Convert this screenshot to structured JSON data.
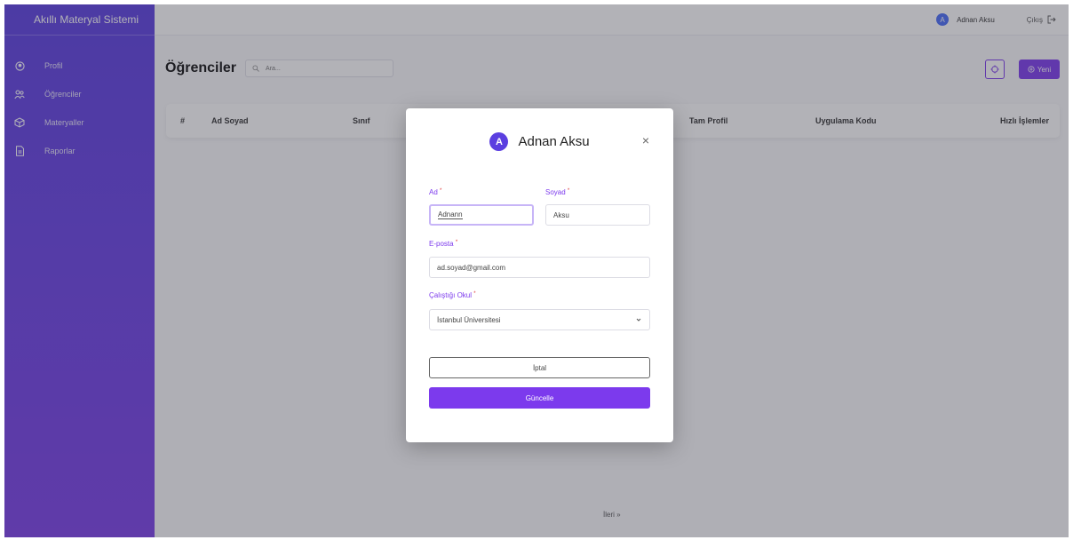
{
  "app": {
    "brand": "Akıllı Materyal Sistemi"
  },
  "sidebar": {
    "items": [
      {
        "label": "Profil",
        "icon": "user-circle-icon"
      },
      {
        "label": "Öğrenciler",
        "icon": "users-icon"
      },
      {
        "label": "Materyaller",
        "icon": "box-icon"
      },
      {
        "label": "Raporlar",
        "icon": "file-icon"
      }
    ]
  },
  "topbar": {
    "user_initial": "A",
    "user_name": "Adnan Aksu",
    "logout_label": "Çıkış"
  },
  "page": {
    "title": "Öğrenciler",
    "search_placeholder": "Ara...",
    "new_label": "Yeni",
    "columns": [
      "#",
      "Ad Soyad",
      "Sınıf",
      "Tam Profil",
      "Uygulama Kodu",
      "Hızlı İşlemler"
    ],
    "pager_next": "İleri »"
  },
  "modal": {
    "initial": "A",
    "title": "Adnan Aksu",
    "close": "×",
    "first_name_label": "Ad",
    "first_name_value": "Adnann",
    "last_name_label": "Soyad",
    "last_name_value": "Aksu",
    "email_label": "E-posta",
    "email_value": "ad.soyad@gmail.com",
    "school_label": "Çalıştığı Okul",
    "school_value": "İstanbul Üniversitesi",
    "required_mark": "*",
    "cancel_label": "İptal",
    "update_label": "Güncelle"
  },
  "colors": {
    "accent": "#7c3aed",
    "sidebar_top": "#5b3fe0",
    "avatar": "#4a6cf7"
  }
}
